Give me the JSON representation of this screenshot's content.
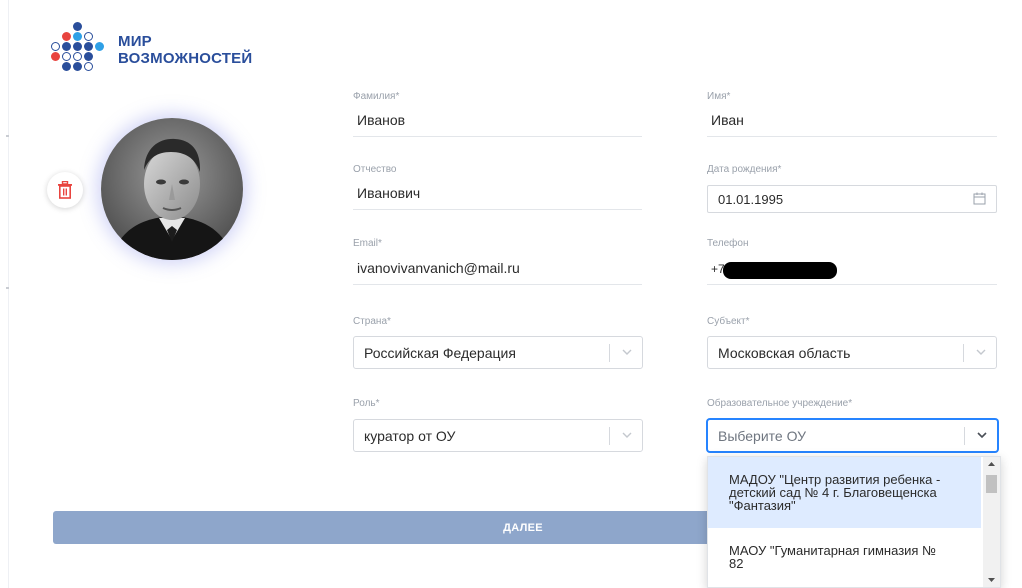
{
  "logo": {
    "line1": "МИР",
    "line2": "ВОЗМОЖНОСТЕЙ",
    "dot_colors": {
      "red": "#e8443f",
      "blue": "#2a4e9b",
      "light": "#2fa0e6"
    }
  },
  "avatar": {
    "alt": "Фото профиля"
  },
  "form": {
    "last_name": {
      "label": "Фамилия",
      "required_mark": "*",
      "value": "Иванов"
    },
    "first_name": {
      "label": "Имя",
      "required_mark": "*",
      "value": "Иван"
    },
    "patronymic": {
      "label": "Отчество",
      "value": "Иванович"
    },
    "birth_date": {
      "label": "Дата рождения",
      "required_mark": "*",
      "value": "01.01.1995"
    },
    "email": {
      "label": "Email",
      "required_mark": "*",
      "value": "ivanovivanvanich@mail.ru"
    },
    "phone": {
      "label": "Телефон",
      "value": "+7-"
    },
    "country": {
      "label": "Страна",
      "required_mark": "*",
      "value": "Российская Федерация"
    },
    "region": {
      "label": "Субъект",
      "required_mark": "*",
      "value": "Московская область"
    },
    "role": {
      "label": "Роль",
      "required_mark": "*",
      "value": "куратор от ОУ"
    },
    "institution": {
      "label": "Образовательное учреждение",
      "required_mark": "*",
      "placeholder": "Выберите ОУ"
    }
  },
  "dropdown": {
    "options": [
      {
        "line1": "МАДОУ \"Центр развития ребенка -",
        "line2": "детский сад № 4 г. Благовещенска",
        "line3": "\"Фантазия\"",
        "highlighted": true
      },
      {
        "line1": "МАОУ \"Гуманитарная гимназия №",
        "line2": "82",
        "highlighted": false
      }
    ]
  },
  "buttons": {
    "next": "ДАЛЕЕ"
  },
  "colors": {
    "accent": "#2684ff",
    "button": "#8ea6cb",
    "option_highlight": "#deebff",
    "trash": "#e8443f"
  }
}
